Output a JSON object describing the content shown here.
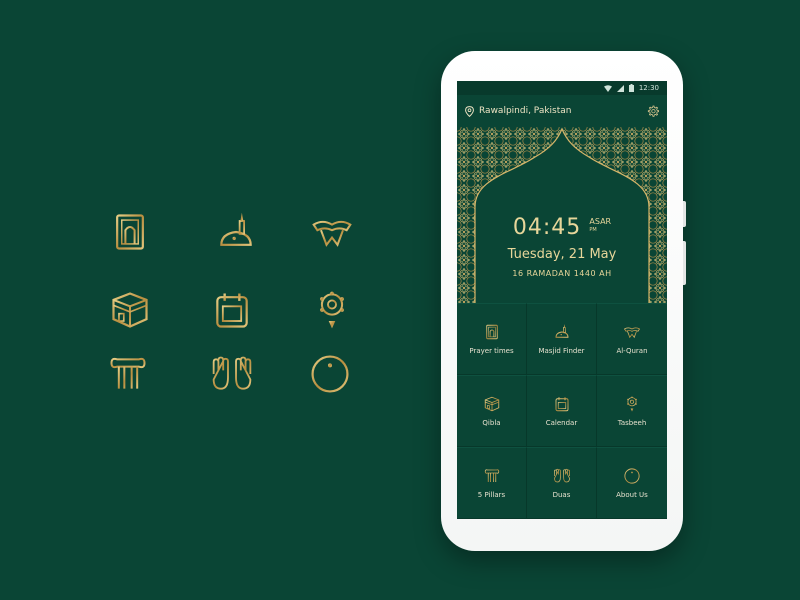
{
  "colors": {
    "background": "#0a4535",
    "gold": "#c9a85e",
    "text": "#e7d69a"
  },
  "status_bar": {
    "time": "12:30"
  },
  "header": {
    "location": "Rawalpindi, Pakistan",
    "location_icon": "location-pin-icon",
    "settings_icon": "gear-icon"
  },
  "prayer": {
    "time": "04:45",
    "name": "ASAR",
    "period": "PM"
  },
  "date": {
    "gregorian": "Tuesday, 21 May",
    "hijri": "16 RAMADAN 1440 AH"
  },
  "menu": [
    {
      "label": "Prayer times",
      "icon": "prayer-mat-icon"
    },
    {
      "label": "Masjid Finder",
      "icon": "mosque-icon"
    },
    {
      "label": "Al-Quran",
      "icon": "quran-icon"
    },
    {
      "label": "Qibla",
      "icon": "kaaba-icon"
    },
    {
      "label": "Calendar",
      "icon": "calendar-icon"
    },
    {
      "label": "Tasbeeh",
      "icon": "tasbeeh-icon"
    },
    {
      "label": "5 Pillars",
      "icon": "pillars-icon"
    },
    {
      "label": "Duas",
      "icon": "dua-hands-icon"
    },
    {
      "label": "About Us",
      "icon": "info-icon"
    }
  ]
}
